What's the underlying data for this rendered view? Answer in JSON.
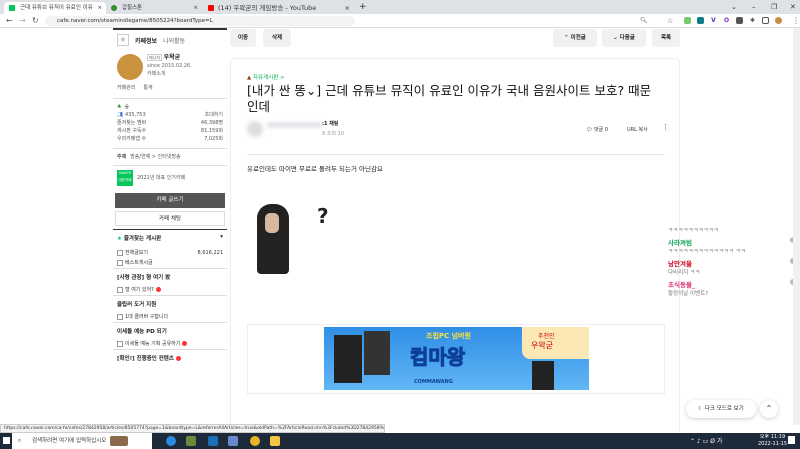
{
  "browser": {
    "tabs": [
      {
        "label": "근데 유튜브 뮤직이 유료인 이유"
      },
      {
        "label": "갑힐스톤"
      },
      {
        "label": "(14) 우왁굳의 게임방송 - YouTube"
      }
    ],
    "new_tab": "+",
    "url": "cafe.naver.com/steamindiegame/8505224?boardType=L"
  },
  "sidebar": {
    "tabs": [
      "카페정보",
      "나의활동"
    ],
    "manager_badge": "매니저",
    "manager": "우왁굳",
    "since": "since 2015.02.26.",
    "intro": "카페소개",
    "manage": "카페관리",
    "stats": "통계",
    "level": "숲",
    "members": "435,753",
    "invite": "초대하기",
    "info": [
      {
        "label": "즐겨찾는 멤버",
        "value": "46,398명"
      },
      {
        "label": "게시판 구독수",
        "value": "81,159회"
      },
      {
        "label": "우리카페앱 수",
        "value": "7,025회"
      }
    ],
    "topic_label": "주제",
    "topic": "방송/연예 > 인터넷방송",
    "award_badge": "NAVER 대표카페",
    "award": "2021년 대표 인기카페",
    "write": "카페 글쓰기",
    "chat": "카페 채팅",
    "fav_title": "즐겨찾는 게시판",
    "items": [
      {
        "type": "item",
        "label": "전체글보기",
        "count": "8,616,221"
      },
      {
        "type": "item",
        "label": "베스트게시글"
      },
      {
        "type": "head",
        "label": "[사령 관장] 형 여기 봤"
      },
      {
        "type": "item",
        "label": "형 여기 있어?",
        "new": true
      },
      {
        "type": "head",
        "label": "클립러 도거 지원"
      },
      {
        "type": "item",
        "label": "1대 클러버 구합니다"
      },
      {
        "type": "head",
        "label": "이세돌 예능 PD 되기"
      },
      {
        "type": "item",
        "label": "이세돌 예능 기획 공유하기",
        "new": true
      },
      {
        "type": "head",
        "label": "[확인!] 진행중인 컨텐츠",
        "new": true
      }
    ]
  },
  "toolbar": {
    "move": "이동",
    "delete": "삭제",
    "prev": "이전글",
    "next": "다음글",
    "list": "목록"
  },
  "article": {
    "board": "자유게시판 >",
    "title": "[내가 싼 똥⌄] 근데 유튜브 뮤직이 유료인 이유가 국내 음원사이트 보호? 때문인데",
    "author_level": ":1 채팅",
    "meta": "8  조회 10",
    "comments": "댓글 0",
    "url_copy": "URL 복사",
    "body": "유료인데도 따이면 무료로 돌려두 되는거 아닌감요",
    "qmark": "?",
    "banner": {
      "top": "조립PC 넘버원",
      "main": "컴마왕",
      "rec": "추천인",
      "rec_name": "우왁굳",
      "brand": "COMMAWANG"
    }
  },
  "chat": [
    {
      "text": "ㅋㅋㅋㅋㅋㅋㅋㅋㅋㅋ"
    },
    {
      "name": "사라져빔",
      "color": "#0aa34f",
      "text": "ㅋㅋㅋㅋㅋㅋㅋㅋㅋㅋㅋㅋㅋ ㅋㅋ"
    },
    {
      "name": "낭만겨울",
      "color": "#d0021b",
      "text": "다비리지 ㅋㅋ"
    },
    {
      "name": "초식동물_",
      "color": "#d63c7c",
      "text": "황정의날 이벤트?"
    }
  ],
  "dark_mode": "다크 모드로 보기",
  "top_btn": "⌃",
  "status_url": "https://cafe.naver.com/ca-fe/cafes/27842958/articles/8505774?page=1&boardtype=L&referrerAllArticles=true&oldPath=%2FArticleRead.nhn%3Fclubid%3D27842958%26page%3D1%26boardtype%3DL%26articleid%3D8505774%26referrerAllArticles%3Dtrue",
  "taskbar": {
    "search": "검색하려면 여기에 입력하십시오",
    "time": "오후 11:19",
    "date": "2022-11-15"
  }
}
